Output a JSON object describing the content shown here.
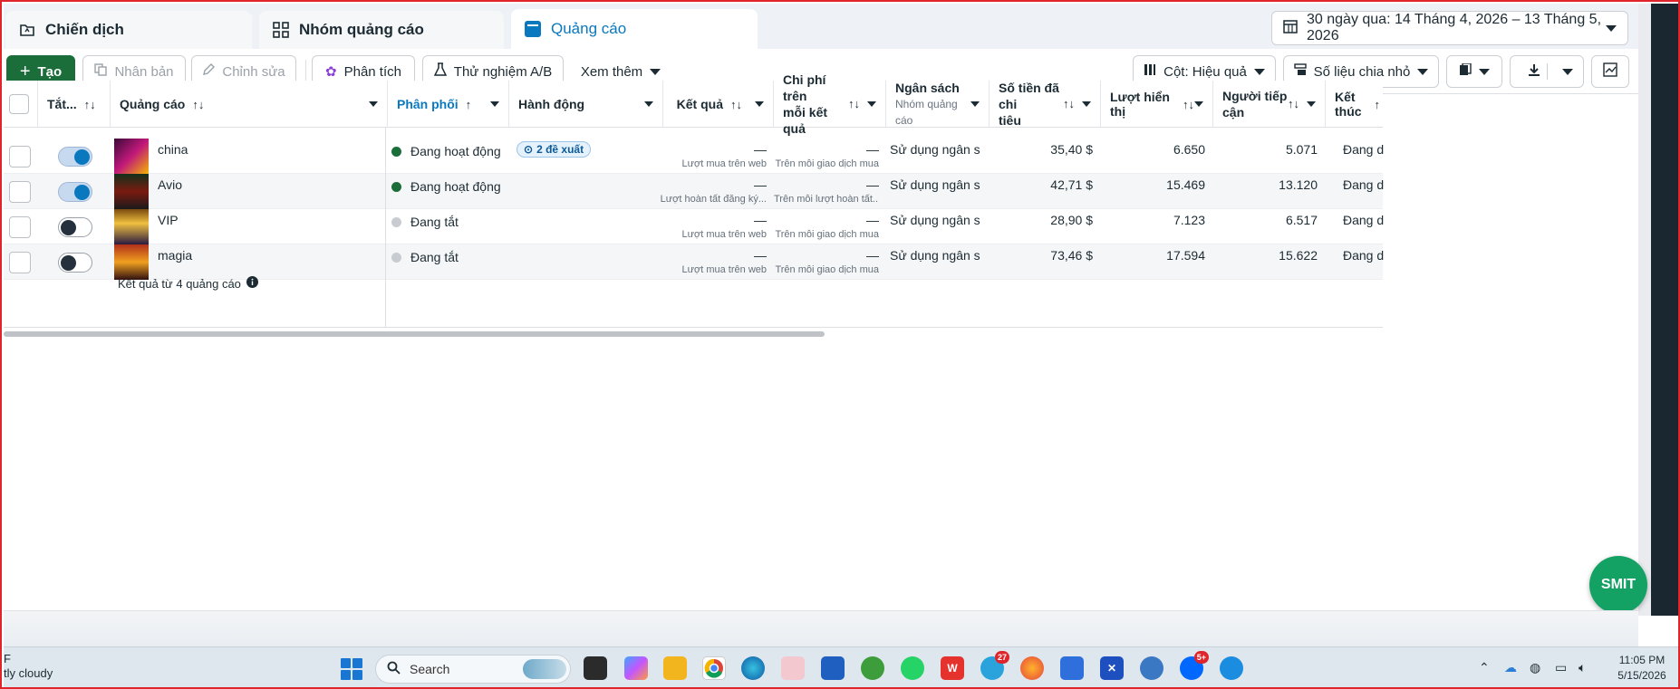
{
  "tabs": [
    {
      "label": "Chiến dịch",
      "icon": "folder-icon"
    },
    {
      "label": "Nhóm quảng cáo",
      "icon": "grid-icon"
    },
    {
      "label": "Quảng cáo",
      "icon": "ad-icon",
      "active": true
    }
  ],
  "date_range": "30 ngày qua: 14 Tháng 4, 2026 – 13 Tháng 5, 2026",
  "toolbar": {
    "create": "Tạo",
    "duplicate": "Nhân bản",
    "edit": "Chỉnh sửa",
    "analyze": "Phân tích",
    "ab_test": "Thử nghiệm A/B",
    "more": "Xem thêm",
    "columns": "Cột: Hiệu quả",
    "breakdown": "Số liệu chia nhỏ"
  },
  "columns": {
    "toggle": "Tắt...",
    "ad": "Quảng cáo",
    "delivery": "Phân phối",
    "actions": "Hành động",
    "results": "Kết quả",
    "cost_per_result_1": "Chi phí trên",
    "cost_per_result_2": "mỗi kết quả",
    "budget": "Ngân sách",
    "budget_sub": "Nhóm quảng cáo",
    "amount_spent_1": "Số tiền đã chi",
    "amount_spent_2": "tiêu",
    "impressions": "Lượt hiển thị",
    "reach_1": "Người tiếp",
    "reach_2": "cận",
    "ends": "Kết thúc"
  },
  "rows": [
    {
      "name": "china",
      "on": true,
      "status": "Đang hoạt động",
      "status_color": "#1b6e3a",
      "suggestion": "2 đề xuất",
      "result": "—",
      "result_type": "Lượt mua trên web",
      "cpr": "—",
      "cpr_type": "Trên mỗi giao dịch mua",
      "budget": "Sử dụng ngân s...",
      "spent": "35,40 $",
      "impressions": "6.650",
      "reach": "5.071",
      "ends": "Đang diễ"
    },
    {
      "name": "Avio",
      "on": true,
      "status": "Đang hoạt động",
      "status_color": "#1b6e3a",
      "suggestion": "",
      "result": "—",
      "result_type": "Lượt hoàn tất đăng ký...",
      "cpr": "—",
      "cpr_type": "Trên mỗi lượt hoàn tất...",
      "budget": "Sử dụng ngân s...",
      "spent": "42,71 $",
      "impressions": "15.469",
      "reach": "13.120",
      "ends": "Đang diễ"
    },
    {
      "name": "VIP",
      "on": false,
      "status": "Đang tắt",
      "status_color": "#c8ccd1",
      "suggestion": "",
      "result": "—",
      "result_type": "Lượt mua trên web",
      "cpr": "—",
      "cpr_type": "Trên mỗi giao dịch mua",
      "budget": "Sử dụng ngân s...",
      "spent": "28,90 $",
      "impressions": "7.123",
      "reach": "6.517",
      "ends": "Đang diễ"
    },
    {
      "name": "magia",
      "on": false,
      "status": "Đang tắt",
      "status_color": "#c8ccd1",
      "suggestion": "",
      "result": "—",
      "result_type": "Lượt mua trên web",
      "cpr": "—",
      "cpr_type": "Trên mỗi giao dịch mua",
      "budget": "Sử dụng ngân s...",
      "spent": "73,46 $",
      "impressions": "17.594",
      "reach": "15.622",
      "ends": "Đang diễ"
    }
  ],
  "summary": "Kết quả từ 4 quảng cáo",
  "smit_label": "SMIT",
  "taskbar": {
    "weather_line1": "F",
    "weather_line2": "tly cloudy",
    "search_placeholder": "Search",
    "telegram_badge": "27",
    "zalo_badge": "5+",
    "time": "11:05 PM",
    "date": "5/15/2026"
  }
}
